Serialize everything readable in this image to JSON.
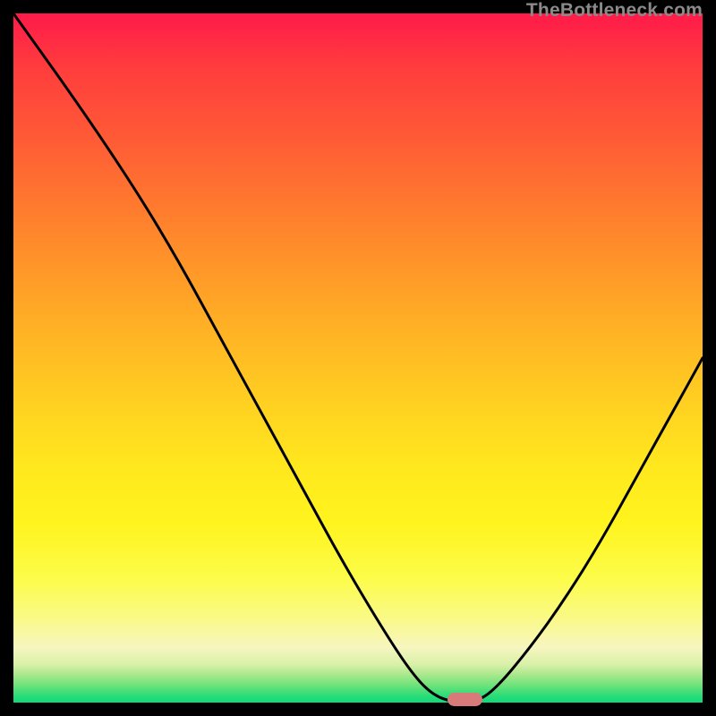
{
  "watermark": "TheBottleneck.com",
  "chart_data": {
    "type": "line",
    "title": "",
    "xlabel": "",
    "ylabel": "",
    "x_range": [
      0,
      1
    ],
    "y_range": [
      0,
      1
    ],
    "background": "heatmap-gradient-vertical",
    "gradient_stops": [
      {
        "pos": 0.0,
        "color": "#ff1a4a"
      },
      {
        "pos": 0.5,
        "color": "#ffd420"
      },
      {
        "pos": 0.97,
        "color": "#10d97a"
      }
    ],
    "series": [
      {
        "name": "bottleneck-curve",
        "color": "#000000",
        "points": [
          {
            "x": 0.0,
            "y": 1.0
          },
          {
            "x": 0.1,
            "y": 0.86
          },
          {
            "x": 0.18,
            "y": 0.74
          },
          {
            "x": 0.24,
            "y": 0.64
          },
          {
            "x": 0.3,
            "y": 0.53
          },
          {
            "x": 0.36,
            "y": 0.42
          },
          {
            "x": 0.42,
            "y": 0.31
          },
          {
            "x": 0.48,
            "y": 0.2
          },
          {
            "x": 0.54,
            "y": 0.1
          },
          {
            "x": 0.58,
            "y": 0.04
          },
          {
            "x": 0.61,
            "y": 0.01
          },
          {
            "x": 0.64,
            "y": 0.0
          },
          {
            "x": 0.67,
            "y": 0.0
          },
          {
            "x": 0.7,
            "y": 0.02
          },
          {
            "x": 0.75,
            "y": 0.08
          },
          {
            "x": 0.8,
            "y": 0.15
          },
          {
            "x": 0.85,
            "y": 0.23
          },
          {
            "x": 0.9,
            "y": 0.32
          },
          {
            "x": 0.95,
            "y": 0.41
          },
          {
            "x": 1.0,
            "y": 0.5
          }
        ]
      }
    ],
    "marker": {
      "name": "optimum-marker",
      "color": "#d97a7a",
      "x_center": 0.655,
      "width": 0.05,
      "y": 0.0
    }
  }
}
